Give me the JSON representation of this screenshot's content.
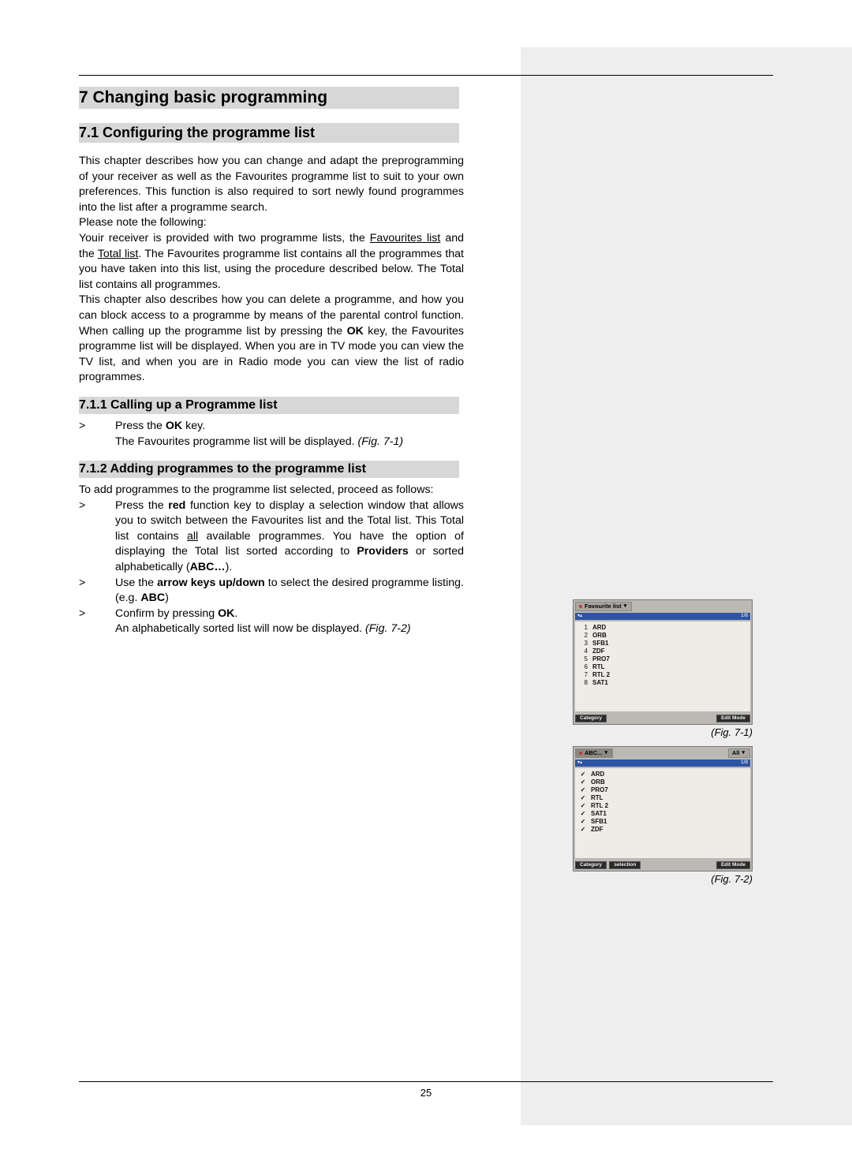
{
  "page_number": "25",
  "h1": "7 Changing basic programming",
  "h2": "7.1 Configuring the programme list",
  "intro_1": "This chapter describes how you can change and adapt the preprogramming of your receiver as well as the Favourites programme list to suit to your own preferences. This function is also required to sort newly found programmes into the list after a programme search.",
  "intro_2": "Please note the following:",
  "intro_3a": "Youir receiver is provided with two programme lists, the ",
  "intro_3_fav": "Favourites list",
  "intro_3b": " and the ",
  "intro_3_total": "Total list",
  "intro_3c": ". The Favourites programme list contains all the programmes that you have taken into this list, using the procedure described below. The Total list contains all programmes.",
  "intro_4a": "This chapter also describes how you can delete a programme, and how you can block access to a programme by means of the parental control function. When calling up the programme list by pressing the ",
  "intro_4_ok": "OK",
  "intro_4b": " key, the Favourites programme list will be displayed. When you are in TV mode you can view the TV list, and when you are in Radio mode you can view the list of radio programmes.",
  "h3_1": "7.1.1 Calling up a Programme list",
  "s1a": "Press the ",
  "s1_ok": "OK",
  "s1b": "  key.",
  "s1c": "The Favourites programme list will be displayed. ",
  "s1_fig": "(Fig. 7-1)",
  "h3_2": "7.1.2 Adding programmes to the programme  list",
  "add_intro": "To add programmes to the programme list selected, proceed as follows:",
  "s2a": "Press the ",
  "s2_red": "red",
  "s2b": " function key to display a selection window that allows you to switch between the Favourites list and the Total list. This Total list contains ",
  "s2_all": "all",
  "s2c": " available programmes. You have the option of displaying the Total list sorted according to ",
  "s2_prov": "Providers",
  "s2d": " or sorted alphabetically (",
  "s2_abc": "ABC…",
  "s2e": ").",
  "s3a": "Use the ",
  "s3_arrow": "arrow keys up/down",
  "s3b": " to select the desired programme listing. (e.g. ",
  "s3_abc": "ABC",
  "s3c": ")",
  "s4a": "Confirm by pressing ",
  "s4_ok": "OK",
  "s4b": ".",
  "s4c": "An alphabetically sorted list will now be displayed. ",
  "s4_fig": "(Fig. 7-2)",
  "marker": ">",
  "fig1": {
    "tab": "Favourite list",
    "page_ind": "1/8",
    "rows": [
      {
        "n": "1",
        "label": "ARD"
      },
      {
        "n": "2",
        "label": "ORB"
      },
      {
        "n": "3",
        "label": "SFB1"
      },
      {
        "n": "4",
        "label": "ZDF"
      },
      {
        "n": "5",
        "label": "PRO7"
      },
      {
        "n": "6",
        "label": "RTL"
      },
      {
        "n": "7",
        "label": "RTL 2"
      },
      {
        "n": "8",
        "label": "SAT1"
      }
    ],
    "foot_left": "Category",
    "foot_right": "Edit Mode",
    "caption": "(Fig. 7-1)"
  },
  "fig2": {
    "tab1": "ABC...",
    "tab2": "All",
    "page_ind": "1/8",
    "rows": [
      {
        "label": "ARD"
      },
      {
        "label": "ORB"
      },
      {
        "label": "PRO7"
      },
      {
        "label": "RTL"
      },
      {
        "label": "RTL 2"
      },
      {
        "label": "SAT1"
      },
      {
        "label": "SFB1"
      },
      {
        "label": "ZDF"
      }
    ],
    "foot_left": "Category",
    "foot_mid": "selection",
    "foot_right": "Edit Mode",
    "caption": "(Fig. 7-2)"
  }
}
